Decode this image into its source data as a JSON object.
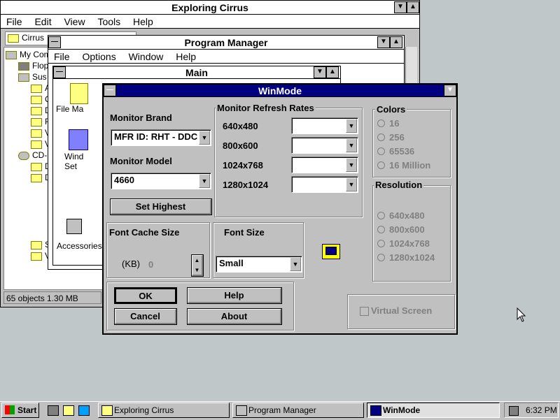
{
  "explorer": {
    "title": "Exploring Cirrus",
    "menu": [
      "File",
      "Edit",
      "View",
      "Tools",
      "Help"
    ],
    "location": "Cirrus",
    "tree": [
      "My Comp",
      "Flopp",
      "Sus",
      "A",
      "C",
      "D",
      "F",
      "V",
      "V",
      "CD-R",
      "D",
      "D",
      "S",
      "V"
    ],
    "status": "65 objects   1.30 MB"
  },
  "program_manager": {
    "title": "Program Manager",
    "menu": [
      "File",
      "Options",
      "Window",
      "Help"
    ],
    "main_title": "Main",
    "icons": [
      "File Ma",
      "Wind Set"
    ],
    "accessories": "Accessories"
  },
  "winmode": {
    "title": "WinMode",
    "monitor_brand_label": "Monitor Brand",
    "monitor_brand_value": "MFR ID: RHT - DDC",
    "monitor_model_label": "Monitor Model",
    "monitor_model_value": "4660",
    "set_highest": "Set Highest",
    "refresh_title": "Monitor Refresh Rates",
    "refresh_rows": [
      "640x480",
      "800x600",
      "1024x768",
      "1280x1024"
    ],
    "colors_title": "Colors",
    "colors": [
      "16",
      "256",
      "65536",
      "16 Million"
    ],
    "resolution_title": "Resolution",
    "resolutions": [
      "640x480",
      "800x600",
      "1024x768",
      "1280x1024"
    ],
    "font_cache_title": "Font Cache Size",
    "font_cache_unit": "(KB)",
    "font_cache_value": "0",
    "font_size_title": "Font Size",
    "font_size_value": "Small",
    "ok": "OK",
    "help": "Help",
    "cancel": "Cancel",
    "about": "About",
    "virtual_screen": "Virtual Screen"
  },
  "taskbar": {
    "start": "Start",
    "tasks": [
      "Exploring Cirrus",
      "Program Manager",
      "WinMode"
    ],
    "clock": "6:32 PM"
  }
}
